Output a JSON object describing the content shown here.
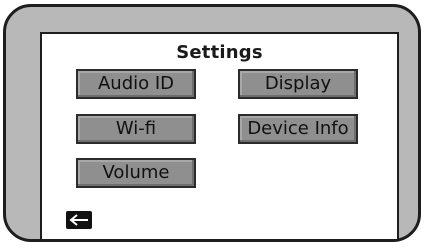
{
  "screen": {
    "title": "Settings"
  },
  "menu": {
    "audio_id": "Audio ID",
    "display": "Display",
    "wifi": "Wi-fi",
    "device_info": "Device Info",
    "volume": "Volume"
  },
  "icons": {
    "back": "left-arrow-icon"
  },
  "colors": {
    "device_bezel": "#b8b8b8",
    "button_fill": "#8f8f8f",
    "screen_bg": "#ffffff",
    "back_button_bg": "#111111"
  }
}
